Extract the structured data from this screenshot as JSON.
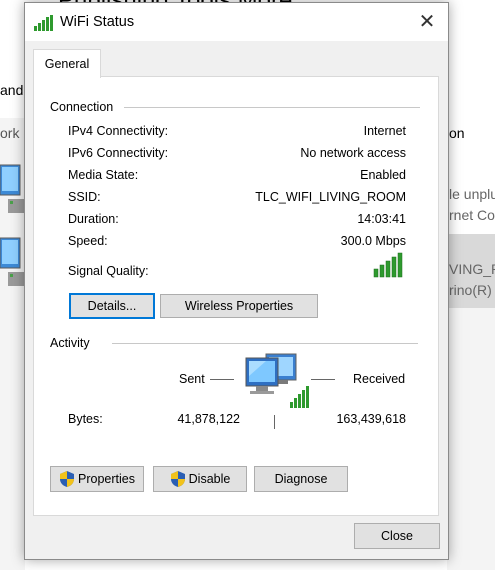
{
  "background": {
    "title_text": "Publishing Tools        More",
    "left_texts": [
      "and",
      "ork c"
    ],
    "right_texts": [
      "on",
      "le unplu",
      "rnet Con",
      "VING_RO",
      "rino(R)"
    ]
  },
  "dialog": {
    "title": "WiFi Status",
    "close_glyph": "✕",
    "tab_general": "General",
    "connection": {
      "heading": "Connection",
      "rows": [
        {
          "label": "IPv4 Connectivity:",
          "value": "Internet"
        },
        {
          "label": "IPv6 Connectivity:",
          "value": "No network access"
        },
        {
          "label": "Media State:",
          "value": "Enabled"
        },
        {
          "label": "SSID:",
          "value": "TLC_WIFI_LIVING_ROOM"
        },
        {
          "label": "Duration:",
          "value": "14:03:41"
        },
        {
          "label": "Speed:",
          "value": "300.0 Mbps"
        }
      ],
      "signal_label": "Signal Quality:",
      "signal_bars": 5
    },
    "buttons_top": {
      "details": "Details...",
      "wireless": "Wireless Properties"
    },
    "activity": {
      "heading": "Activity",
      "sent_label": "Sent",
      "received_label": "Received",
      "bytes_label": "Bytes:",
      "bytes_sent": "41,878,122",
      "bytes_received": "163,439,618"
    },
    "buttons_bottom": {
      "properties": "Properties",
      "disable": "Disable",
      "diagnose": "Diagnose"
    },
    "close_button": "Close"
  },
  "colors": {
    "accent": "#0078d7",
    "signal_green": "#2e9a2e",
    "shield_blue": "#2b5fb4",
    "shield_yellow": "#f2c21b"
  }
}
